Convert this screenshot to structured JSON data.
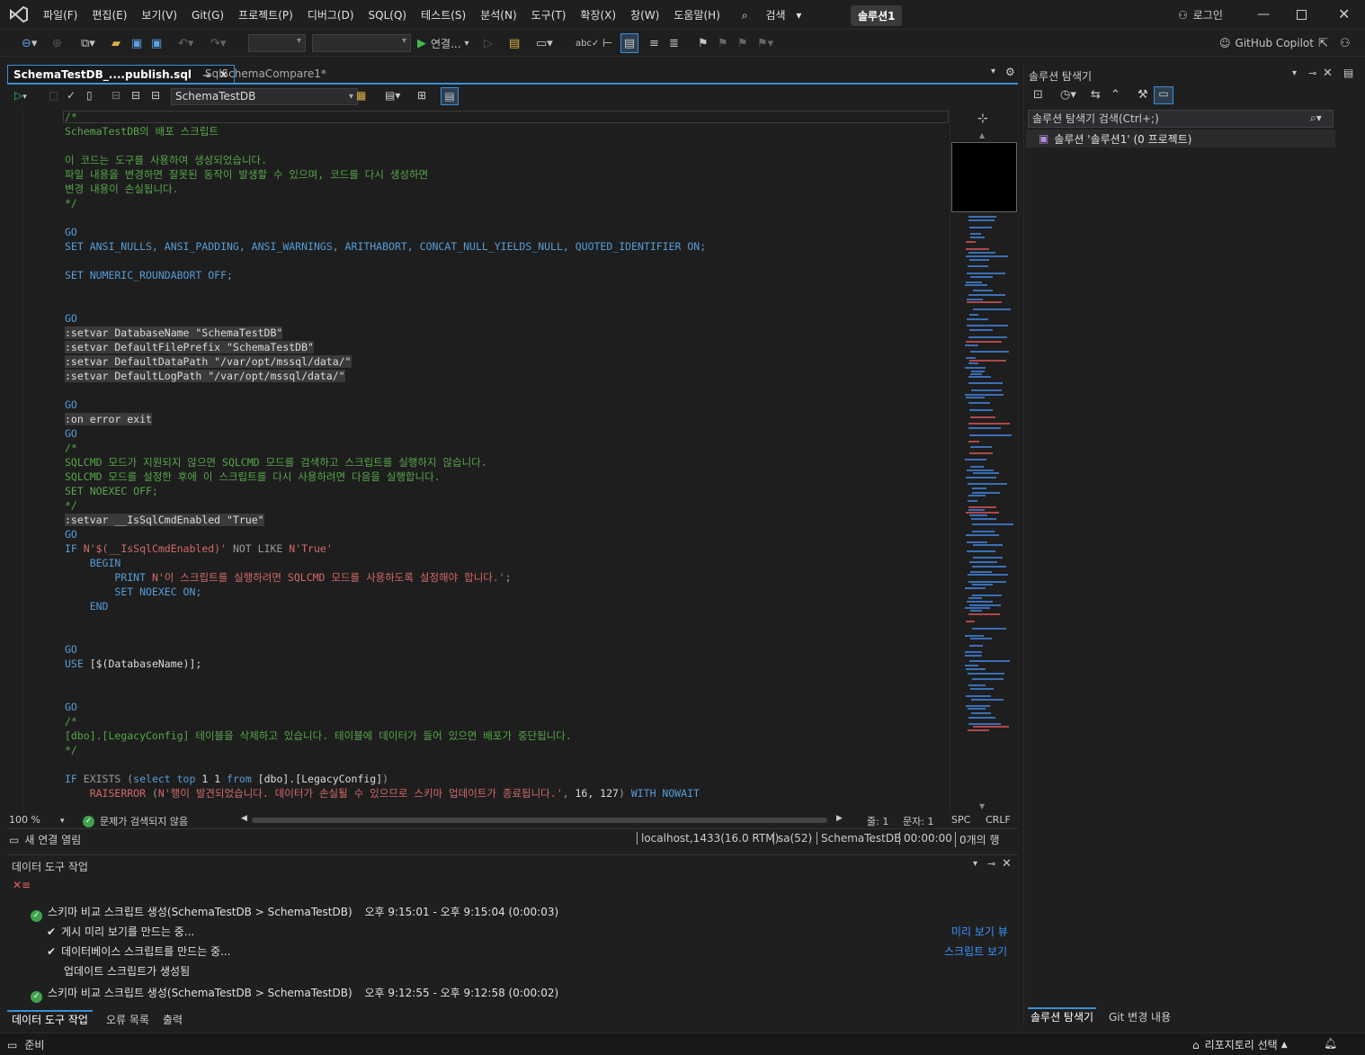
{
  "menu": {
    "items": [
      "파일(F)",
      "편집(E)",
      "보기(V)",
      "Git(G)",
      "프로젝트(P)",
      "디버그(D)",
      "SQL(Q)",
      "테스트(S)",
      "분석(N)",
      "도구(T)",
      "확장(X)",
      "창(W)",
      "도움말(H)"
    ],
    "search_label": "검색",
    "solution_name": "솔루션1",
    "login_label": "로그인"
  },
  "toolbar": {
    "connect_label": "연결...",
    "copilot_label": "GitHub Copilot"
  },
  "tabs": {
    "active": "SchemaTestDB_....publish.sql",
    "inactive": "SqlSchemaCompare1*"
  },
  "editor_toolbar": {
    "database": "SchemaTestDB"
  },
  "code": [
    [
      [
        "cm",
        "/*"
      ]
    ],
    [
      [
        "cm",
        "SchemaTestDB의 배포 스크립트"
      ]
    ],
    [],
    [
      [
        "cm",
        "이 코드는 도구를 사용하여 생성되었습니다."
      ]
    ],
    [
      [
        "cm",
        "파일 내용을 변경하면 잘못된 동작이 발생할 수 있으며, 코드를 다시 생성하면"
      ]
    ],
    [
      [
        "cm",
        "변경 내용이 손실됩니다."
      ]
    ],
    [
      [
        "cm",
        "*/"
      ]
    ],
    [],
    [
      [
        "kw",
        "GO"
      ]
    ],
    [
      [
        "kw",
        "SET ANSI_NULLS, ANSI_PADDING, ANSI_WARNINGS, ARITHABORT, CONCAT_NULL_YIELDS_NULL, QUOTED_IDENTIFIER ON;"
      ]
    ],
    [],
    [
      [
        "kw",
        "SET NUMERIC_ROUNDABORT OFF;"
      ]
    ],
    [],
    [],
    [
      [
        "kw",
        "GO"
      ]
    ],
    [
      [
        "hl",
        ":setvar DatabaseName \"SchemaTestDB\""
      ]
    ],
    [
      [
        "hl",
        ":setvar DefaultFilePrefix \"SchemaTestDB\""
      ]
    ],
    [
      [
        "hl",
        ":setvar DefaultDataPath \"/var/opt/mssql/data/\""
      ]
    ],
    [
      [
        "hl",
        ":setvar DefaultLogPath \"/var/opt/mssql/data/\""
      ]
    ],
    [],
    [
      [
        "kw",
        "GO"
      ]
    ],
    [
      [
        "hl",
        ":on error exit"
      ]
    ],
    [
      [
        "kw",
        "GO"
      ]
    ],
    [
      [
        "cm",
        "/*"
      ]
    ],
    [
      [
        "cm",
        "SQLCMD 모드가 지원되지 않으면 SQLCMD 모드를 검색하고 스크립트를 실행하지 않습니다."
      ]
    ],
    [
      [
        "cm",
        "SQLCMD 모드를 설정한 후에 이 스크립트를 다시 사용하려면 다음을 실행합니다."
      ]
    ],
    [
      [
        "cm",
        "SET NOEXEC OFF;"
      ]
    ],
    [
      [
        "cm",
        "*/"
      ]
    ],
    [
      [
        "hl",
        ":setvar __IsSqlCmdEnabled \"True\""
      ]
    ],
    [
      [
        "kw",
        "GO"
      ]
    ],
    [
      [
        "kw",
        "IF "
      ],
      [
        "st",
        "N'$(__IsSqlCmdEnabled)'"
      ],
      [
        "gr",
        " NOT LIKE "
      ],
      [
        "st",
        "N'True'"
      ]
    ],
    [
      [
        "tx",
        "    "
      ],
      [
        "kw",
        "BEGIN"
      ]
    ],
    [
      [
        "tx",
        "        "
      ],
      [
        "kw",
        "PRINT "
      ],
      [
        "st",
        "N'이 스크립트를 실행하려면 SQLCMD 모드를 사용하도록 설정해야 합니다.'"
      ],
      [
        "gr",
        ";"
      ]
    ],
    [
      [
        "tx",
        "        "
      ],
      [
        "kw",
        "SET NOEXEC ON;"
      ]
    ],
    [
      [
        "tx",
        "    "
      ],
      [
        "kw",
        "END"
      ]
    ],
    [],
    [],
    [
      [
        "kw",
        "GO"
      ]
    ],
    [
      [
        "kw",
        "USE "
      ],
      [
        "tx",
        "[$(DatabaseName)];"
      ]
    ],
    [],
    [],
    [
      [
        "kw",
        "GO"
      ]
    ],
    [
      [
        "cm",
        "/*"
      ]
    ],
    [
      [
        "cm",
        "[dbo].[LegacyConfig] 테이블을 삭제하고 있습니다. 테이블에 데이터가 들어 있으면 배포가 중단됩니다."
      ]
    ],
    [
      [
        "cm",
        "*/"
      ]
    ],
    [],
    [
      [
        "kw",
        "IF "
      ],
      [
        "gr",
        "EXISTS ("
      ],
      [
        "kw",
        "select top "
      ],
      [
        "tx",
        "1 1 "
      ],
      [
        "kw",
        "from "
      ],
      [
        "tx",
        "[dbo].[LegacyConfig]"
      ],
      [
        "gr",
        ")"
      ]
    ],
    [
      [
        "tx",
        "    "
      ],
      [
        "st",
        "RAISERROR "
      ],
      [
        "gr",
        "("
      ],
      [
        "st",
        "N'행이 발견되었습니다. 데이터가 손실될 수 있으므로 스키마 업데이트가 종료됩니다.'"
      ],
      [
        "gr",
        ", "
      ],
      [
        "tx",
        "16, 127"
      ],
      [
        "gr",
        ") "
      ],
      [
        "kw",
        "WITH NOWAIT"
      ]
    ]
  ],
  "editor_status": {
    "zoom": "100 %",
    "issues": "문제가 검색되지 않음",
    "line": "줄: 1",
    "col": "문자: 1",
    "spc": "SPC",
    "crlf": "CRLF"
  },
  "connection": {
    "new_conn": "새 연결 열림",
    "server": "localhost,1433(16.0 RTM)",
    "user": "sa(52)",
    "db": "SchemaTestDB",
    "time": "00:00:00",
    "rows": "0개의 행"
  },
  "data_tools": {
    "title": "데이터 도구 작업",
    "rows": [
      {
        "text": "스키마 비교 스크립트 생성(SchemaTestDB > SchemaTestDB)",
        "time": "오후 9:15:01 - 오후 9:15:04 (0:00:03)"
      },
      {
        "text": "게시 미리 보기를 만드는 중...",
        "link": "미리 보기 뷰"
      },
      {
        "text": "데이터베이스 스크립트를 만드는 중...",
        "link": "스크립트 보기"
      },
      {
        "text": "업데이트 스크립트가 생성됨"
      },
      {
        "text": "스키마 비교 스크립트 생성(SchemaTestDB > SchemaTestDB)",
        "time": "오후 9:12:55 - 오후 9:12:58 (0:00:02)"
      }
    ],
    "bottom_tabs": [
      "데이터 도구 작업",
      "오류 목록",
      "출력"
    ]
  },
  "solution_explorer": {
    "title": "솔루션 탐색기",
    "search_placeholder": "솔루션 탐색기 검색(Ctrl+;)",
    "root": "솔루션 '솔루션1' (0 프로젝트)",
    "bottom_tabs": [
      "솔루션 탐색기",
      "Git 변경 내용"
    ]
  },
  "statusbar": {
    "ready": "준비",
    "repo": "리포지토리 선택"
  },
  "colors": {
    "accent": "#3a8fd6",
    "comment": "#57a64a",
    "keyword": "#569cd6",
    "string": "#d16969",
    "success": "#3fa34d"
  }
}
